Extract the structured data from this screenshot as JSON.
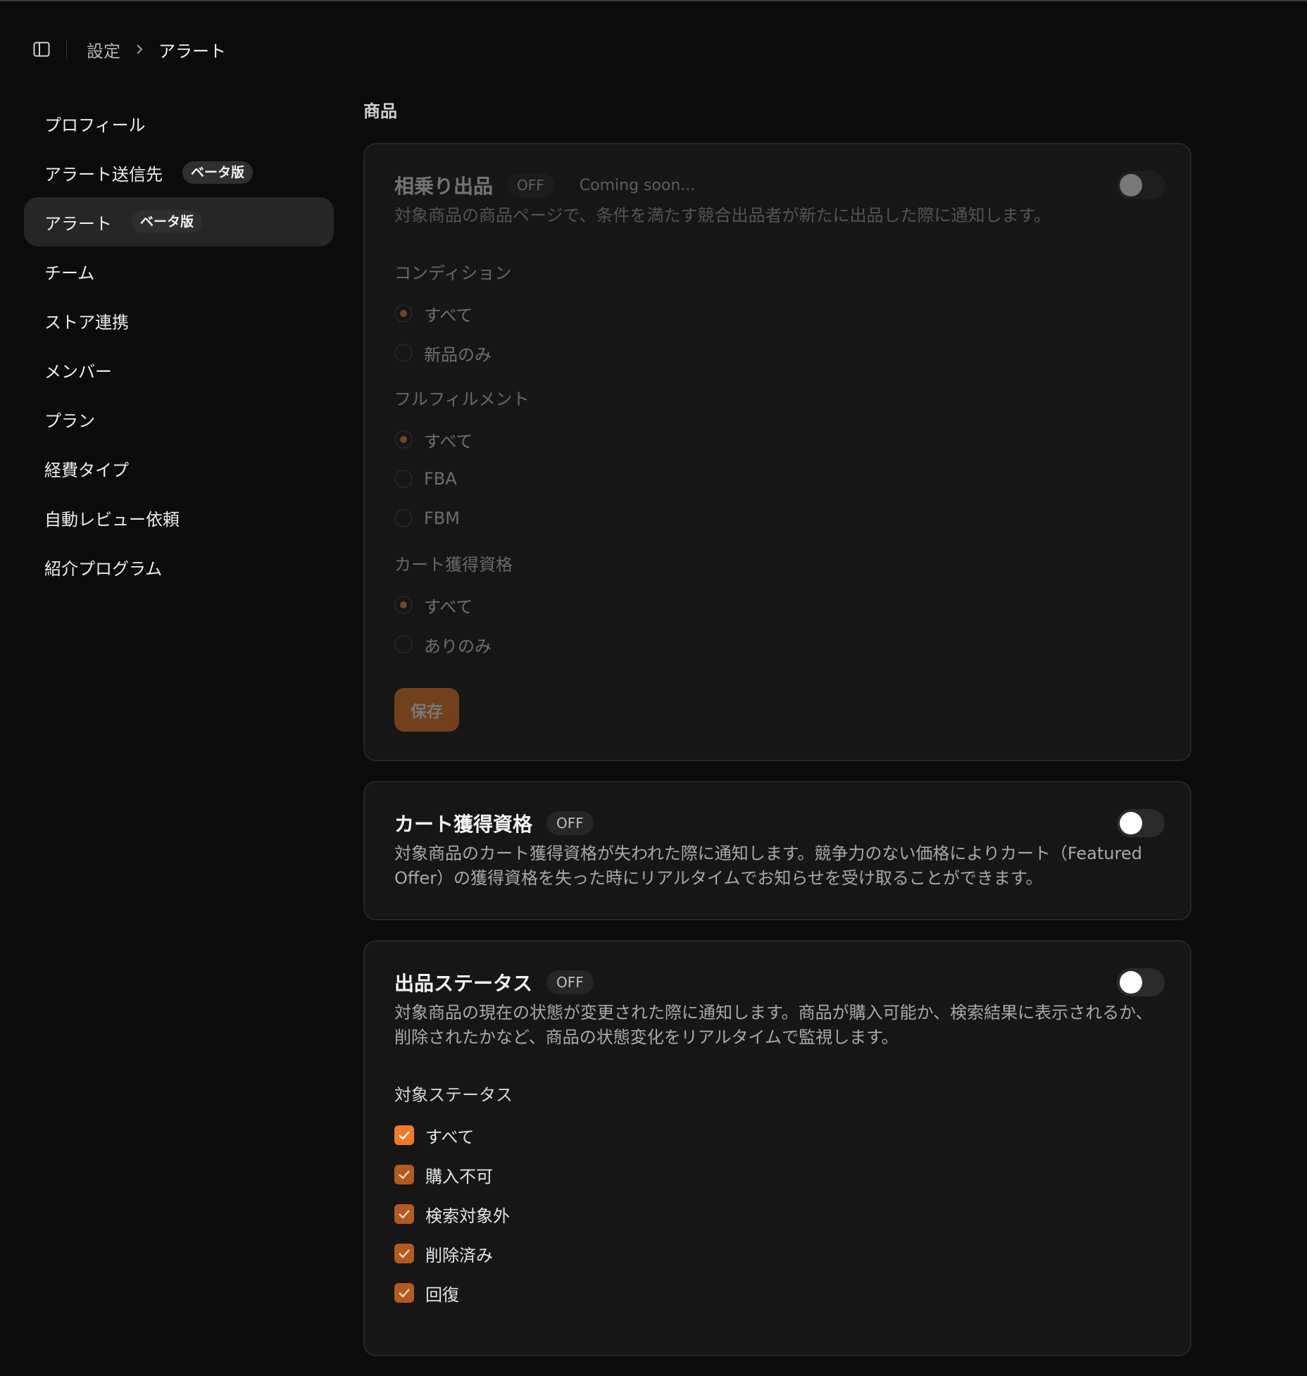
{
  "breadcrumb": {
    "parent": "設定",
    "current": "アラート"
  },
  "sidebar": {
    "items": [
      {
        "label": "プロフィール"
      },
      {
        "label": "アラート送信先",
        "badge": "ベータ版"
      },
      {
        "label": "アラート",
        "badge": "ベータ版",
        "active": true
      },
      {
        "label": "チーム"
      },
      {
        "label": "ストア連携"
      },
      {
        "label": "メンバー"
      },
      {
        "label": "プラン"
      },
      {
        "label": "経費タイプ"
      },
      {
        "label": "自動レビュー依頼"
      },
      {
        "label": "紹介プログラム"
      }
    ]
  },
  "main": {
    "section_title": "商品",
    "card1": {
      "title": "相乗り出品",
      "status": "OFF",
      "note": "Coming soon...",
      "description": "対象商品の商品ページで、条件を満たす競合出品者が新たに出品した際に通知します。",
      "groups": [
        {
          "label": "コンディション",
          "options": [
            "すべて",
            "新品のみ"
          ],
          "selected": 0
        },
        {
          "label": "フルフィルメント",
          "options": [
            "すべて",
            "FBA",
            "FBM"
          ],
          "selected": 0
        },
        {
          "label": "カート獲得資格",
          "options": [
            "すべて",
            "ありのみ"
          ],
          "selected": 0
        }
      ],
      "save_label": "保存"
    },
    "card2": {
      "title": "カート獲得資格",
      "status": "OFF",
      "description": "対象商品のカート獲得資格が失われた際に通知します。競争力のない価格によりカート（Featured Offer）の獲得資格を失った時にリアルタイムでお知らせを受け取ることができます。"
    },
    "card3": {
      "title": "出品ステータス",
      "status": "OFF",
      "description": "対象商品の現在の状態が変更された際に通知します。商品が購入可能か、検索結果に表示されるか、削除されたかなど、商品の状態変化をリアルタイムで監視します。",
      "group_label": "対象ステータス",
      "checkboxes": [
        "すべて",
        "購入不可",
        "検索対象外",
        "削除済み",
        "回復"
      ]
    }
  },
  "colors": {
    "accent": "#f07a28",
    "background": "#0b0b0b",
    "card": "#161616"
  }
}
